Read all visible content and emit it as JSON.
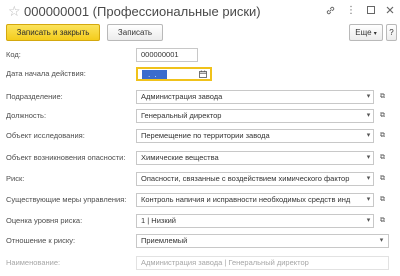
{
  "window": {
    "title": "000000001 (Профессиональные риски)",
    "icons": [
      "link-icon",
      "more-vertical-icon",
      "maximize-icon",
      "close-icon"
    ]
  },
  "toolbar": {
    "save_close_label": "Записать и закрыть",
    "save_label": "Записать",
    "more_label": "Еще",
    "help_label": "?"
  },
  "form": {
    "code_label": "Код:",
    "code_value": "000000001",
    "start_date_label": "Дата начала действия:",
    "start_date_value": "",
    "department_label": "Подразделение:",
    "department_value": "Администрация завода",
    "position_label": "Должность:",
    "position_value": "Генеральный директор",
    "study_object_label": "Объект исследования:",
    "study_object_value": "Перемещение по территории завода",
    "hazard_object_label": "Объект возникновения опасности:",
    "hazard_object_value": "Химические вещества",
    "risk_label": "Риск:",
    "risk_value": "Опасности, связанные с воздействием химического фактор",
    "measures_label": "Существующие меры управления:",
    "measures_value": "Контроль напичия и исправности необходимых средств инд",
    "risk_level_label": "Оценка уровня риска:",
    "risk_level_value": "1 |  Низкий",
    "attitude_label": "Отношение к риску:",
    "attitude_value": "Приемлемый",
    "name_label": "Наименование:",
    "name_value": "Администрация завода |  Генеральный директор"
  }
}
